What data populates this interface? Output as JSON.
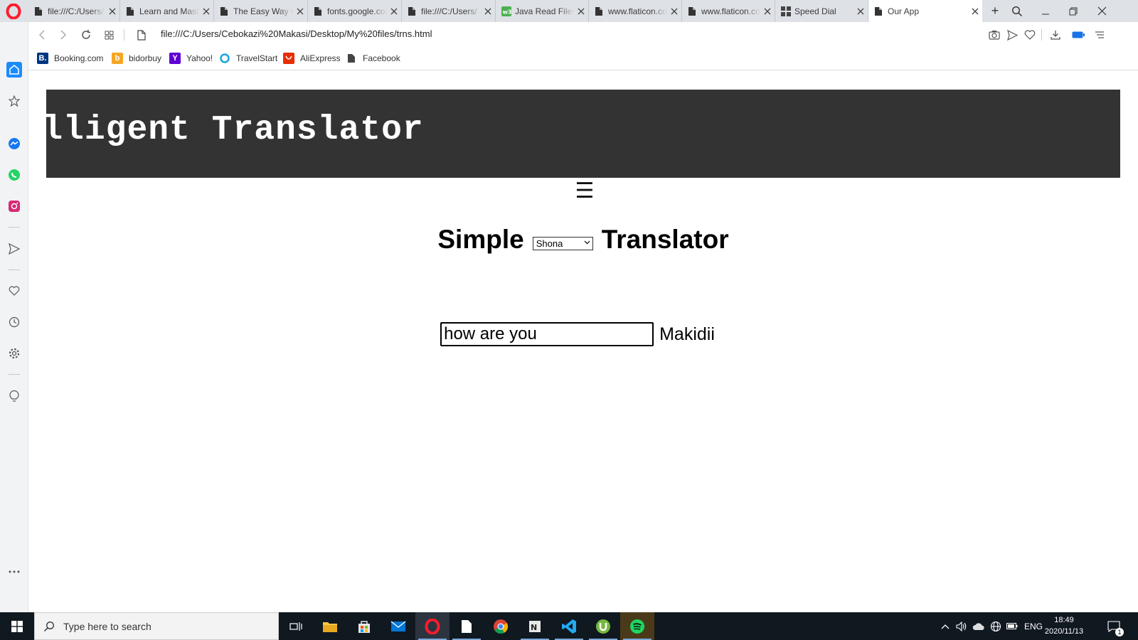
{
  "browser": {
    "tabs": [
      {
        "title": "file:///C:/Users/",
        "icon": "page-icon"
      },
      {
        "title": "Learn and Master",
        "icon": "page-icon"
      },
      {
        "title": "The Easy Way to",
        "icon": "page-icon"
      },
      {
        "title": "fonts.google.com",
        "icon": "page-icon"
      },
      {
        "title": "file:///C:/Users/",
        "icon": "page-icon"
      },
      {
        "title": "Java Read Files",
        "icon": "w3schools-icon"
      },
      {
        "title": "www.flaticon.com",
        "icon": "page-icon"
      },
      {
        "title": "www.flaticon.com",
        "icon": "page-icon"
      },
      {
        "title": "Speed Dial",
        "icon": "speed-dial-icon"
      },
      {
        "title": "Our App",
        "icon": "page-icon",
        "active": true
      }
    ],
    "new_tab_label": "+",
    "url": "file:///C:/Users/Cebokazi%20Makasi/Desktop/My%20files/trns.html",
    "bookmarks": [
      {
        "label": "Booking.com",
        "icon_text": "B.",
        "color": "#003580"
      },
      {
        "label": "bidorbuy",
        "icon_text": "b",
        "color": "#f5a623"
      },
      {
        "label": "Yahoo!",
        "icon_text": "Y",
        "color": "#5f01d1"
      },
      {
        "label": "TravelStart",
        "icon_text": "",
        "color": "#1aa3e0"
      },
      {
        "label": "AliExpress",
        "icon_text": "",
        "color": "#e62e04"
      },
      {
        "label": "Facebook",
        "icon_text": "",
        "color": "#555555"
      }
    ]
  },
  "page": {
    "banner_text": "Intelligent Translator",
    "menu_icon": "☰",
    "title_left": "Simple",
    "title_right": "Translator",
    "language_selected": "Shona",
    "input_value": "how are you",
    "output_text": "Makidii"
  },
  "taskbar": {
    "search_placeholder": "Type here to search",
    "language": "ENG",
    "time": "18:49",
    "date": "2020/11/13",
    "notification_count": "1"
  },
  "colors": {
    "banner_bg": "#333333",
    "tabbar_bg": "#dee1e6",
    "taskbar_bg": "#101820",
    "opera_red": "#ff1b2d"
  }
}
